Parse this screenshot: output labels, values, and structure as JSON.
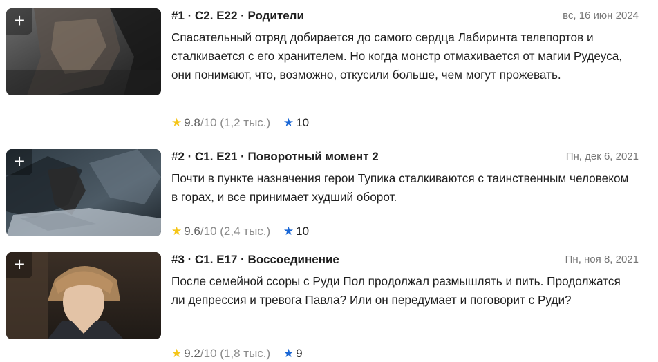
{
  "episodes": [
    {
      "title": "#1 · С2. E22 · Родители",
      "date": "вс, 16 июн 2024",
      "plot": "Спасательный отряд добирается до самого сердца Лабиринта телепортов и сталкивается с его хранителем. Но когда монстр отмахивается от магии Рудеуса, они понимают, что, возможно, откусили больше, чем могут прожевать.",
      "rating": "9.8",
      "rating_max": "/10",
      "votes": "(1,2 тыс.)",
      "user_rating": "10",
      "add_label": "+"
    },
    {
      "title": "#2 · С1. E21 · Поворотный момент 2",
      "date": "Пн, дек 6, 2021",
      "plot": "Почти в пункте назначения герои Тупика сталкиваются с таинственным человеком в горах, и все принимает худший оборот.",
      "rating": "9.6",
      "rating_max": "/10",
      "votes": "(2,4 тыс.)",
      "user_rating": "10",
      "add_label": "+"
    },
    {
      "title": "#3 · С1. E17 · Воссоединение",
      "date": "Пн, ноя 8, 2021",
      "plot": "После семейной ссоры с Руди Пол продолжал размышлять и пить. Продолжатся ли депрессия и тревога Павла? Или он передумает и поговорит с Руди?",
      "rating": "9.2",
      "rating_max": "/10",
      "votes": "(1,8 тыс.)",
      "user_rating": "9",
      "add_label": "+"
    }
  ],
  "icons": {
    "rating_star": "star-icon",
    "user_star": "user-star-icon",
    "add": "plus-icon"
  },
  "colors": {
    "gold_star": "#f5c518",
    "blue_star": "#1a67d6",
    "date_gray": "#757575"
  }
}
